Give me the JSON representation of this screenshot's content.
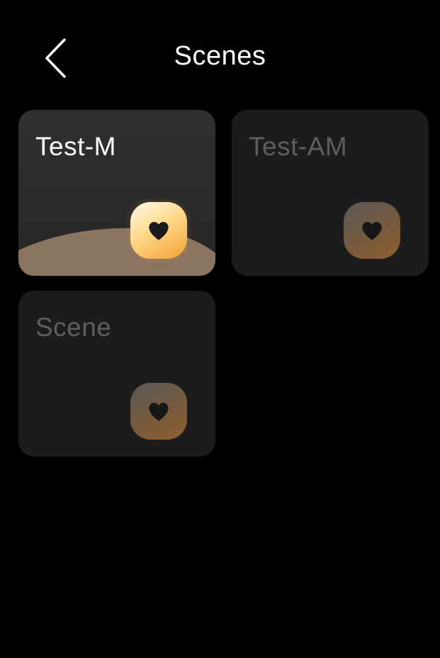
{
  "header": {
    "back_icon": "chevron-left-icon",
    "title": "Scenes"
  },
  "scenes": [
    {
      "label": "Test-M",
      "active": true,
      "icon": "heart-icon"
    },
    {
      "label": "Test-AM",
      "active": false,
      "icon": "heart-icon"
    },
    {
      "label": "Scene",
      "active": false,
      "icon": "heart-icon"
    }
  ],
  "colors": {
    "background": "#000000",
    "card_active": "#2b2b2b",
    "card_inactive": "#1c1c1c",
    "label_active": "#ffffff",
    "label_inactive": "#5e5e5e",
    "accent_orange": "#f3a134",
    "hill": "#8b7560"
  }
}
